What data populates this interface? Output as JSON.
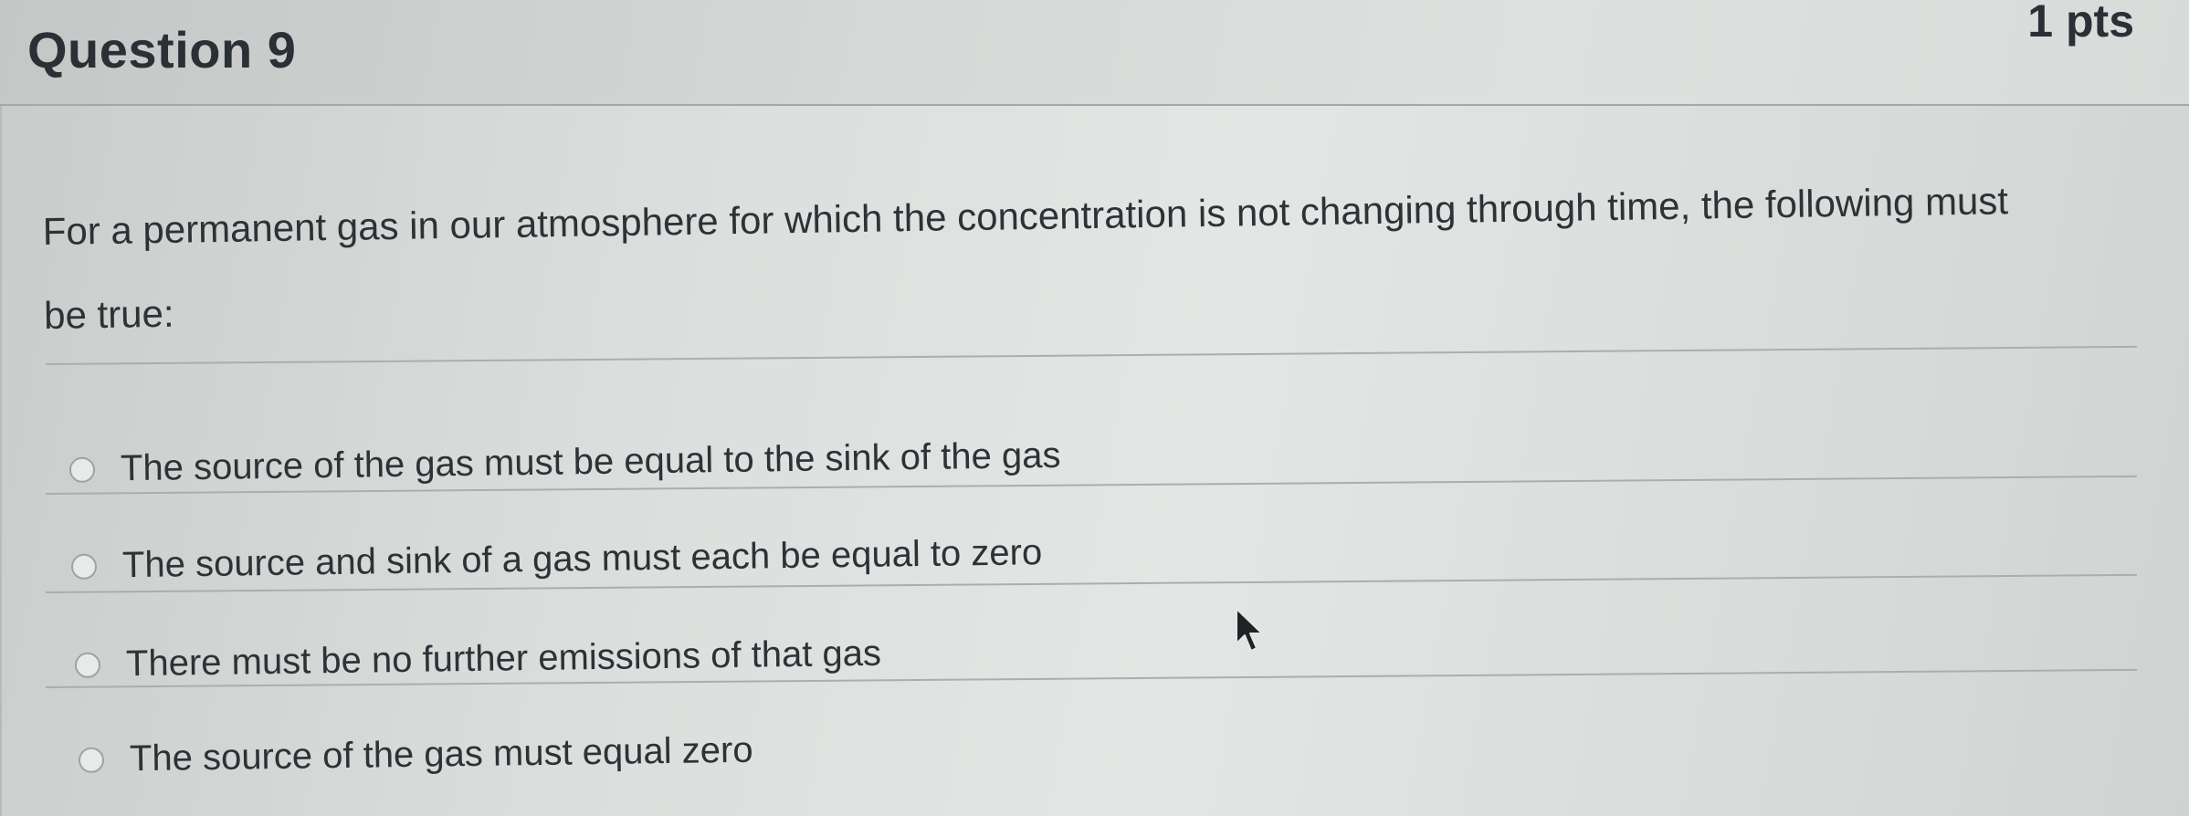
{
  "question": {
    "title": "Question 9",
    "points": "1 pts",
    "text": "For a permanent gas in our atmosphere for which the concentration is not changing through time, the following must be true:"
  },
  "answers": [
    {
      "label": "The source of the gas must be equal to the sink of the gas",
      "selected": false
    },
    {
      "label": "The source and sink of a gas must each be equal to zero",
      "selected": false
    },
    {
      "label": "There must be no further emissions of that gas",
      "selected": false
    },
    {
      "label": "The source of the gas must equal zero",
      "selected": false
    }
  ],
  "icons": {
    "cursor": "mouse-pointer-icon",
    "radio": "radio-button-icon"
  },
  "colors": {
    "text": "#2d3236",
    "divider": "#a9aeae",
    "radio_border": "#9ea3a3"
  }
}
